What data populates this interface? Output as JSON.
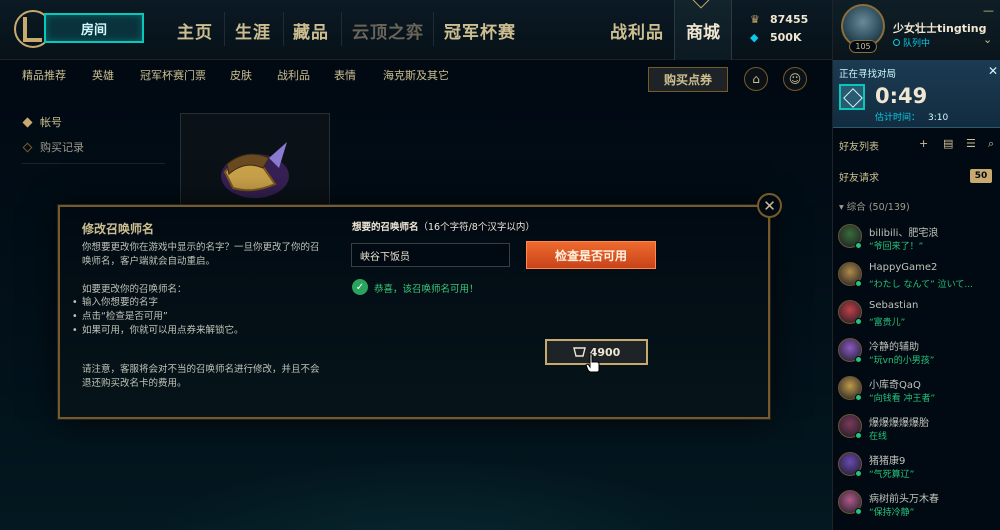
{
  "topnav": {
    "play_label": "房间",
    "items": [
      "主页",
      "生涯",
      "藏品",
      "云顶之弈",
      "冠军杯赛",
      "战利品",
      "商城"
    ],
    "currency": {
      "be": "87455",
      "rp": "500K"
    }
  },
  "subnav": {
    "items": [
      "精品推荐",
      "英雄",
      "冠军杯赛门票",
      "皮肤",
      "战利品",
      "表情",
      "海克斯及其它"
    ],
    "buy_rp": "购买点券"
  },
  "account_menu": {
    "items": [
      "帐号",
      "购买记录"
    ]
  },
  "modal": {
    "title": "修改召唤师名",
    "intro": [
      "你想要更改你在游戏中显示的名字？一旦你更改了你的召",
      "唤师名，客户端就会自动重启。"
    ],
    "howto_title": "如要更改你的召唤师名：",
    "steps": [
      "输入你想要的名字",
      "点击“检查是否可用”",
      "如果可用，你就可以用点券来解锁它。"
    ],
    "note": [
      "请注意，客服将会对不当的召唤师名进行修改，并且不会",
      "退还购买改名卡的费用。"
    ],
    "desired_label": "想要的召唤师名",
    "desired_hint": "（16个字符/8个汉字以内）",
    "name_value": "峡谷下饭员",
    "check_button": "检查是否可用",
    "success": "恭喜，该召唤师名可用！",
    "price": "4900"
  },
  "profile": {
    "name": "少女壮士tingting",
    "level": "105",
    "status": "队列中"
  },
  "queue": {
    "title": "正在寻找对局",
    "time": "0:49",
    "estimate_label": "估计时间：",
    "estimate_value": "3:10"
  },
  "friends": {
    "header": "好友列表",
    "requests_label": "好友请求",
    "requests_count": "50",
    "group": "综合 (50/139)",
    "list": [
      {
        "name": "bilibili、肥宅浪",
        "status": "“爷回来了！”",
        "color": "#3a6a3a"
      },
      {
        "name": "HappyGame2",
        "status": "“わたし なんて” 泣いて...",
        "color": "#b08a4a"
      },
      {
        "name": "Sebastian",
        "status": "“富贵儿”",
        "color": "#c0404a"
      },
      {
        "name": "冷静的辅助",
        "status": "“玩vn的小男孩”",
        "color": "#8a5ac0"
      },
      {
        "name": "小库奇QaQ",
        "status": "“向钱看 冲王者”",
        "color": "#c09a4a"
      },
      {
        "name": "爆爆爆爆爆胎",
        "status": "在线",
        "color": "#7a3a5a"
      },
      {
        "name": "猪猪康9",
        "status": "“气死算辽”",
        "color": "#6a4ab0"
      },
      {
        "name": "病树前头万木春",
        "status": "“保持冷静”",
        "color": "#b05a8a"
      }
    ]
  }
}
